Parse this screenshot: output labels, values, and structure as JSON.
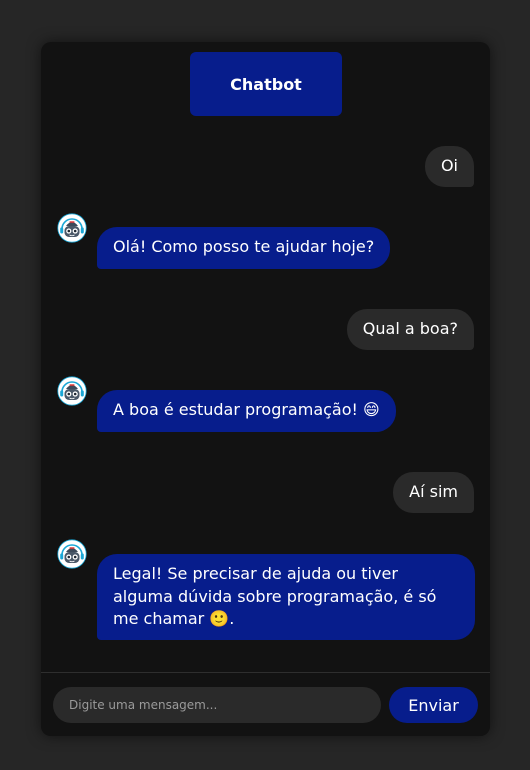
{
  "header": {
    "title": "Chatbot"
  },
  "messages": [
    {
      "sender": "user",
      "text": "Oi"
    },
    {
      "sender": "bot",
      "text": "Olá! Como posso te ajudar hoje?"
    },
    {
      "sender": "user",
      "text": "Qual a boa?"
    },
    {
      "sender": "bot",
      "text": "A boa é estudar programação! 😄"
    },
    {
      "sender": "user",
      "text": "Aí sim"
    },
    {
      "sender": "bot",
      "text": "Legal! Se precisar de ajuda ou tiver alguma dúvida sobre programação, é só me chamar 🙂."
    }
  ],
  "input": {
    "placeholder": "Digite uma mensagem...",
    "value": ""
  },
  "send_button": {
    "label": "Enviar"
  },
  "icons": {
    "bot_avatar": "robot-avatar-icon"
  },
  "colors": {
    "page_background": "#262626",
    "window_background": "#121212",
    "accent": "#071d8c",
    "user_bubble": "#2a2a2a",
    "text": "#ffffff"
  }
}
